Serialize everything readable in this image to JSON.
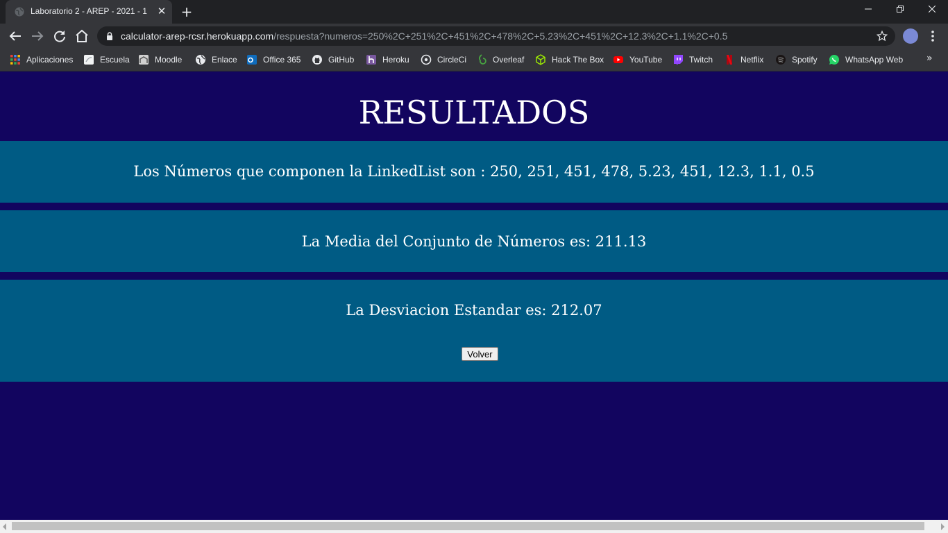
{
  "browser": {
    "tab_title": "Laboratorio 2 - AREP - 2021 - 1",
    "new_tab_symbol": "+",
    "url_host": "calculator-arep-rcsr.herokuapp.com",
    "url_path": "/respuesta?numeros=250%2C+251%2C+451%2C+478%2C+5.23%2C+451%2C+12.3%2C+1.1%2C+0.5",
    "bookmarks": [
      {
        "label": "Aplicaciones",
        "icon": "apps-grid-icon"
      },
      {
        "label": "Escuela",
        "icon": "page-icon"
      },
      {
        "label": "Moodle",
        "icon": "moodle-icon"
      },
      {
        "label": "Enlace",
        "icon": "globe-icon"
      },
      {
        "label": "Office 365",
        "icon": "outlook-icon"
      },
      {
        "label": "GitHub",
        "icon": "github-icon"
      },
      {
        "label": "Heroku",
        "icon": "heroku-icon"
      },
      {
        "label": "CircleCi",
        "icon": "circleci-icon"
      },
      {
        "label": "Overleaf",
        "icon": "overleaf-icon"
      },
      {
        "label": "Hack The Box",
        "icon": "hackthebox-icon"
      },
      {
        "label": "YouTube",
        "icon": "youtube-icon"
      },
      {
        "label": "Twitch",
        "icon": "twitch-icon"
      },
      {
        "label": "Netflix",
        "icon": "netflix-icon"
      },
      {
        "label": "Spotify",
        "icon": "spotify-icon"
      },
      {
        "label": "WhatsApp Web",
        "icon": "whatsapp-icon"
      }
    ],
    "more_bookmarks": "»"
  },
  "page": {
    "title": "RESULTADOS",
    "linkedlist_text": "Los Números que componen la LinkedList son : 250, 251, 451, 478, 5.23, 451, 12.3, 1.1, 0.5",
    "mean_text": "La Media del Conjunto de Números es: 211.13",
    "stddev_text": "La Desviacion Estandar es: 212.07",
    "volver_label": "Volver"
  },
  "colors": {
    "page_background": "#12055f",
    "band_background": "#005b84",
    "text": "#ffffff"
  }
}
